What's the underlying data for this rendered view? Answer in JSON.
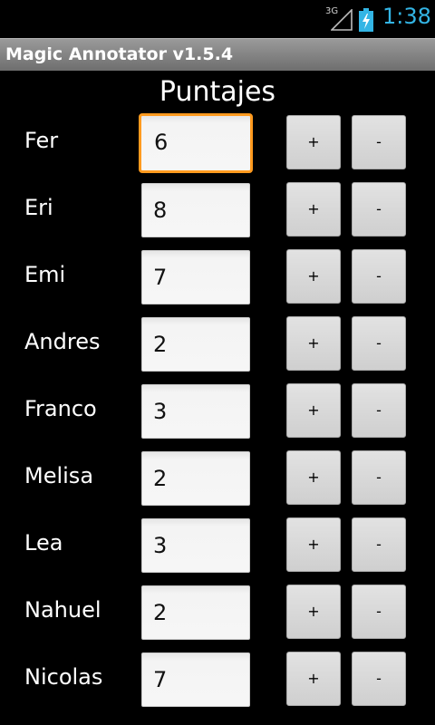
{
  "status_bar": {
    "network": "3G",
    "time": "1:38",
    "clock_color": "#33b5e5",
    "icons": [
      "signal-icon",
      "battery-charging-icon"
    ]
  },
  "title_bar": {
    "title": "Magic Annotator v1.5.4"
  },
  "main": {
    "heading": "Puntajes",
    "focus_color": "#ff9a1e",
    "players": [
      {
        "name": "Fer",
        "score": "6",
        "plus_label": "+",
        "minus_label": "-"
      },
      {
        "name": "Eri",
        "score": "8",
        "plus_label": "+",
        "minus_label": "-"
      },
      {
        "name": "Emi",
        "score": "7",
        "plus_label": "+",
        "minus_label": "-"
      },
      {
        "name": "Andres",
        "score": "2",
        "plus_label": "+",
        "minus_label": "-"
      },
      {
        "name": "Franco",
        "score": "3",
        "plus_label": "+",
        "minus_label": "-"
      },
      {
        "name": "Melisa",
        "score": "2",
        "plus_label": "+",
        "minus_label": "-"
      },
      {
        "name": "Lea",
        "score": "3",
        "plus_label": "+",
        "minus_label": "-"
      },
      {
        "name": "Nahuel",
        "score": "2",
        "plus_label": "+",
        "minus_label": "-"
      },
      {
        "name": "Nicolas",
        "score": "7",
        "plus_label": "+",
        "minus_label": "-"
      }
    ]
  }
}
